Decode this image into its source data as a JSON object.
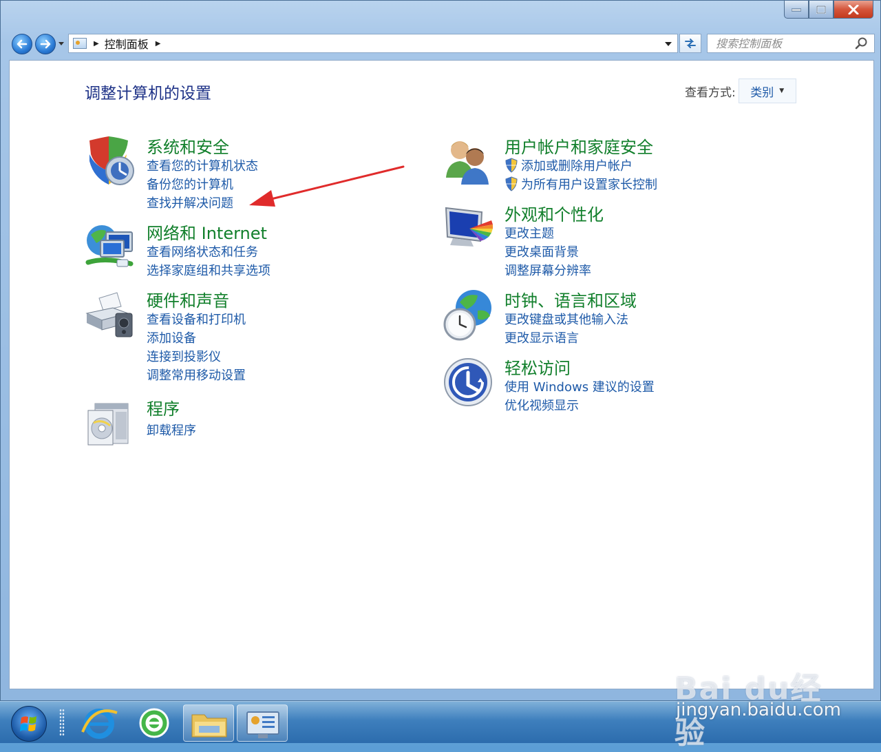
{
  "navigation": {
    "breadcrumb": [
      "控制面板"
    ],
    "search_placeholder": "搜索控制面板"
  },
  "header": {
    "title": "调整计算机的设置",
    "view_by_label": "查看方式:",
    "view_by_value": "类别"
  },
  "categories": [
    {
      "title": "系统和安全",
      "icon": "shield-icon",
      "links": [
        "查看您的计算机状态",
        "备份您的计算机",
        "查找并解决问题"
      ]
    },
    {
      "title": "网络和 Internet",
      "icon": "network-icon",
      "links": [
        "查看网络状态和任务",
        "选择家庭组和共享选项"
      ]
    },
    {
      "title": "硬件和声音",
      "icon": "printer-icon",
      "links": [
        "查看设备和打印机",
        "添加设备",
        "连接到投影仪",
        "调整常用移动设置"
      ]
    },
    {
      "title": "程序",
      "icon": "programs-icon",
      "links": [
        "卸载程序"
      ]
    },
    {
      "title": "用户帐户和家庭安全",
      "icon": "users-icon",
      "links": [
        "添加或删除用户帐户",
        "为所有用户设置家长控制"
      ]
    },
    {
      "title": "外观和个性化",
      "icon": "monitor-icon",
      "links": [
        "更改主题",
        "更改桌面背景",
        "调整屏幕分辨率"
      ]
    },
    {
      "title": "时钟、语言和区域",
      "icon": "clock-globe-icon",
      "links": [
        "更改键盘或其他输入法",
        "更改显示语言"
      ]
    },
    {
      "title": "轻松访问",
      "icon": "ease-of-access-icon",
      "links": [
        "使用 Windows 建议的设置",
        "优化视频显示"
      ]
    }
  ],
  "watermark": {
    "brand": "Bai du经验",
    "url": "jingyan.baidu.com"
  },
  "colors": {
    "category_title": "#117f2b",
    "link": "#1e5aa8",
    "page_title": "#1e3287",
    "annotation_arrow": "#e02b2b"
  }
}
